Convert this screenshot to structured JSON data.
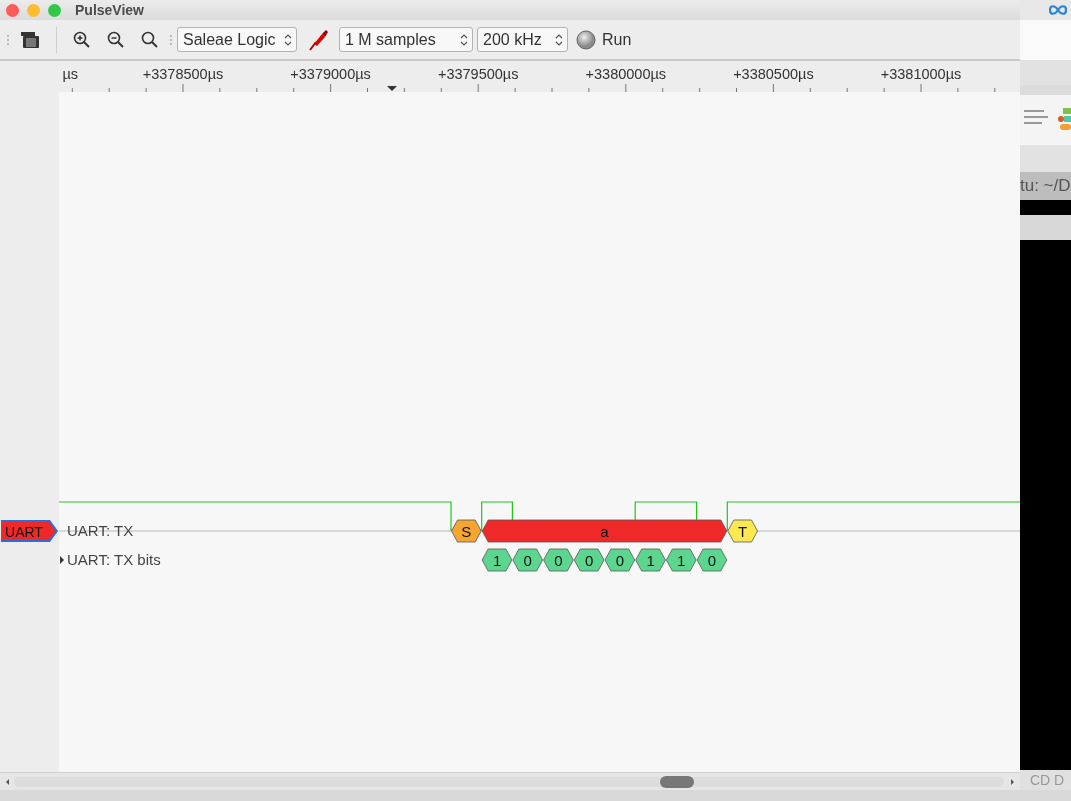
{
  "window": {
    "title": "PulseView"
  },
  "toolbar": {
    "device": "Saleae Logic",
    "samples": "1 M samples",
    "samplerate": "200 kHz",
    "run_button": "Run"
  },
  "ruler": {
    "labels": [
      "µs",
      "+3378500µs",
      "+3379000µs",
      "+3379500µs",
      "+3380000µs",
      "+3380500µs",
      "+3381000µs"
    ]
  },
  "decoder": {
    "badge": "UART",
    "color": "#ef2929",
    "rows": [
      {
        "kind": "annotations",
        "label": "UART: TX",
        "annotations": [
          {
            "kind": "start",
            "text": "S",
            "color": "#f5a531"
          },
          {
            "kind": "data",
            "text": "a",
            "color": "#ef2929"
          },
          {
            "kind": "stop",
            "text": "T",
            "color": "#fce94f"
          }
        ]
      },
      {
        "kind": "bits",
        "label": "UART: TX bits",
        "annotations": [
          {
            "kind": "bit",
            "text": "1",
            "color": "#5cd68f"
          },
          {
            "kind": "bit",
            "text": "0",
            "color": "#5cd68f"
          },
          {
            "kind": "bit",
            "text": "0",
            "color": "#5cd68f"
          },
          {
            "kind": "bit",
            "text": "0",
            "color": "#5cd68f"
          },
          {
            "kind": "bit",
            "text": "0",
            "color": "#5cd68f"
          },
          {
            "kind": "bit",
            "text": "1",
            "color": "#5cd68f"
          },
          {
            "kind": "bit",
            "text": "1",
            "color": "#5cd68f"
          },
          {
            "kind": "bit",
            "text": "0",
            "color": "#5cd68f"
          }
        ]
      }
    ]
  },
  "background": {
    "terminal_title": "tu: ~/D",
    "bottom_text": "CD D"
  }
}
